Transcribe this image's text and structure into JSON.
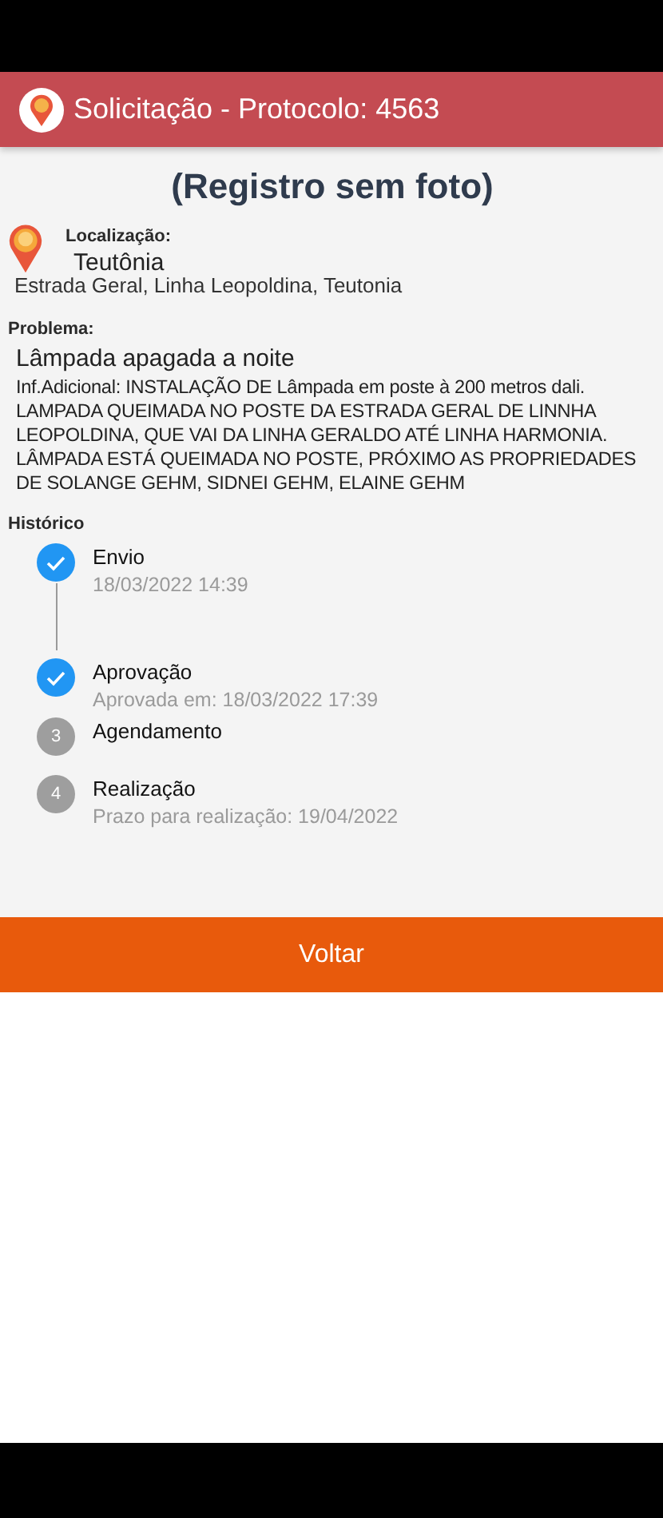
{
  "app_bar": {
    "title": "Solicitação - Protocolo: 4563"
  },
  "photo_note": "(Registro sem foto)",
  "location": {
    "label": "Localização:",
    "city": "Teutônia",
    "address": "Estrada Geral, Linha Leopoldina, Teutonia"
  },
  "problem": {
    "label": "Problema:",
    "title": "Lâmpada apagada a noite",
    "details": "Inf.Adicional: INSTALAÇÃO DE Lâmpada em poste à 200 metros dali. LAMPADA QUEIMADA NO POSTE DA ESTRADA GERAL DE LINNHA LEOPOLDINA, QUE VAI DA LINHA GERALDO ATÉ LINHA HARMONIA. LÂMPADA ESTÁ QUEIMADA NO POSTE, PRÓXIMO AS PROPRIEDADES DE SOLANGE GEHM, SIDNEI GEHM, ELAINE GEHM"
  },
  "history": {
    "label": "Histórico",
    "steps": [
      {
        "done": true,
        "title": "Envio",
        "detail": "18/03/2022 14:39"
      },
      {
        "done": true,
        "title": "Aprovação",
        "detail": "Aprovada em: 18/03/2022 17:39"
      },
      {
        "done": false,
        "number": "3",
        "title": "Agendamento"
      },
      {
        "done": false,
        "number": "4",
        "title": "Realização",
        "detail": "Prazo para realização: 19/04/2022"
      }
    ]
  },
  "back_button": "Voltar"
}
